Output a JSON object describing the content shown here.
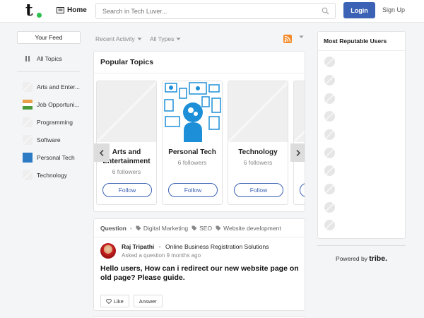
{
  "header": {
    "logo_letter": "t",
    "home_label": "Home",
    "search_placeholder": "Search in Tech Luver...",
    "login_label": "Login",
    "signup_label": "Sign Up",
    "accent_color": "#3b62b5",
    "logo_dot_color": "#2cbf4e"
  },
  "sidebar": {
    "your_feed": "Your Feed",
    "all_topics": "All Topics",
    "items": [
      {
        "label": "Arts and Enter..."
      },
      {
        "label": "Job Opportuni..."
      },
      {
        "label": "Programming"
      },
      {
        "label": "Software"
      },
      {
        "label": "Personal Tech"
      },
      {
        "label": "Technology"
      }
    ]
  },
  "filters": {
    "recent_activity": "Recent Activity",
    "all_types": "All Types"
  },
  "popular": {
    "title": "Popular Topics",
    "topics": [
      {
        "name": "Arts and Entertainment",
        "followers": "6 followers",
        "button": "Follow"
      },
      {
        "name": "Personal Tech",
        "followers": "6 followers",
        "button": "Follow"
      },
      {
        "name": "Technology",
        "followers": "6 followers",
        "button": "Follow"
      }
    ]
  },
  "question": {
    "type_label": "Question",
    "tags": [
      "Digital Marketing",
      "SEO",
      "Website development"
    ],
    "author": "Raj Tripathi",
    "author_org": "Online Business Registration Solutions",
    "asked": "Asked a question 9 months ago",
    "title": "Hello users, How can i redirect our new website page on old page? Please guide.",
    "like_label": "Like",
    "answer_label": "Answer"
  },
  "right": {
    "reputable_title": "Most Reputable Users",
    "powered_by": "Powered by",
    "brand": "tribe."
  }
}
